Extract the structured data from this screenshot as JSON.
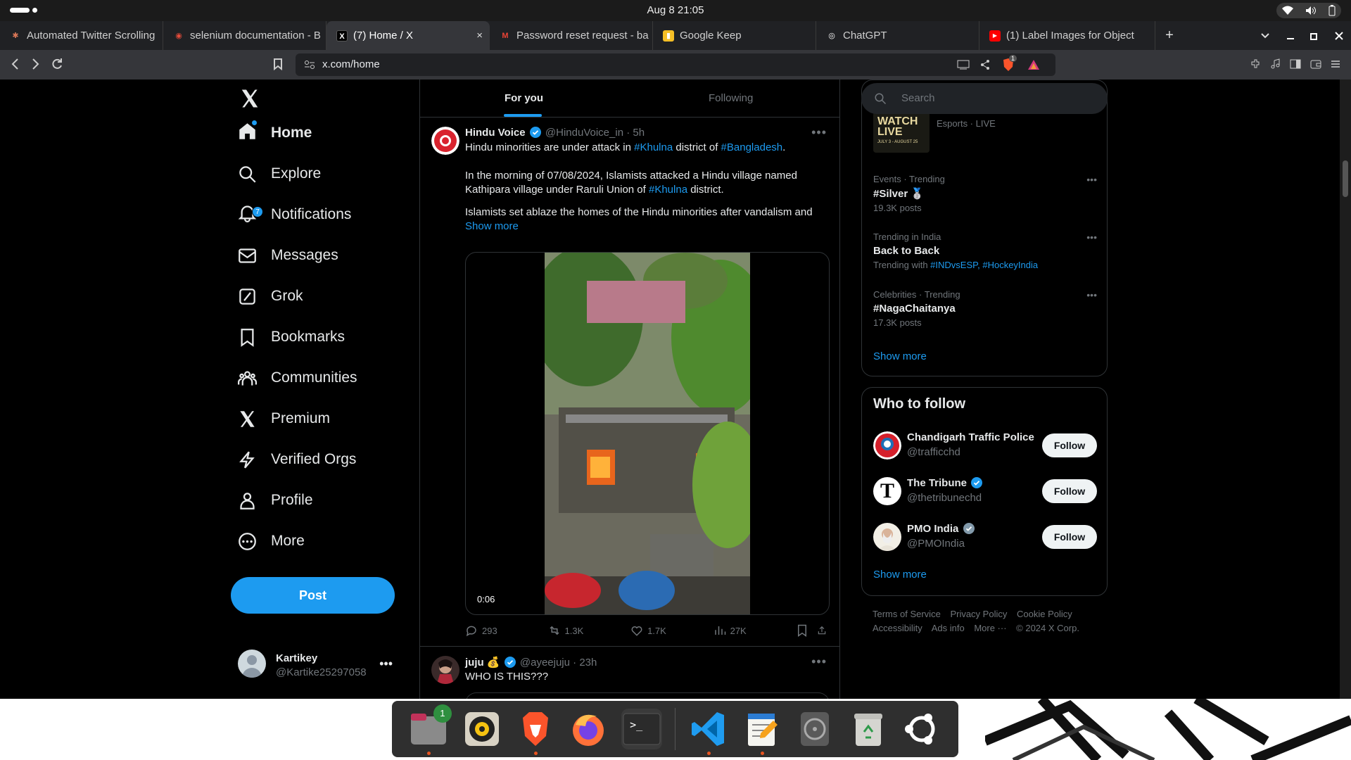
{
  "system": {
    "clock": "Aug 8  21:05"
  },
  "browser": {
    "tabs": [
      {
        "title": "Automated Twitter Scrolling",
        "favicon_color": "#d97757",
        "favicon": "✱"
      },
      {
        "title": "selenium documentation - B",
        "favicon_color": "#e44b3a",
        "favicon": "◉"
      },
      {
        "title": "(7) Home / X",
        "favicon_color": "#000000",
        "favicon": "X",
        "active": true,
        "close": "×"
      },
      {
        "title": "Password reset request - ba",
        "favicon_color": "#ffffff",
        "favicon": "M"
      },
      {
        "title": "Google Keep",
        "favicon_color": "#f6bf26",
        "favicon": "▮"
      },
      {
        "title": "ChatGPT",
        "favicon_color": "#ffffff",
        "favicon": "◎"
      },
      {
        "title": "(1) Label Images for Object",
        "favicon_color": "#ff0000",
        "favicon": "▶"
      }
    ],
    "new_tab": "+",
    "url": "x.com/home",
    "ext_badge": "1"
  },
  "sidebar": {
    "items": [
      {
        "label": "Home",
        "icon": "home-icon"
      },
      {
        "label": "Explore",
        "icon": "search-icon"
      },
      {
        "label": "Notifications",
        "icon": "bell-icon",
        "badge": "7"
      },
      {
        "label": "Messages",
        "icon": "envelope-icon"
      },
      {
        "label": "Grok",
        "icon": "grok-icon"
      },
      {
        "label": "Bookmarks",
        "icon": "bookmark-icon"
      },
      {
        "label": "Communities",
        "icon": "people-icon"
      },
      {
        "label": "Premium",
        "icon": "x-logo-icon"
      },
      {
        "label": "Verified Orgs",
        "icon": "lightning-icon"
      },
      {
        "label": "Profile",
        "icon": "person-icon"
      },
      {
        "label": "More",
        "icon": "more-circle-icon"
      }
    ],
    "post_label": "Post",
    "account": {
      "name": "Kartikey",
      "handle": "@Kartike25297058",
      "menu": "•••"
    }
  },
  "feed": {
    "tabs": [
      "For you",
      "Following"
    ],
    "tweet1": {
      "name": "Hindu Voice",
      "handle": "@HinduVoice_in",
      "sep": " · ",
      "time": "5h",
      "more": "•••",
      "line1_a": "Hindu minorities are under attack in ",
      "line1_tag1": "#Khulna",
      "line1_b": " district of ",
      "line1_tag2": "#Bangladesh",
      "line1_c": ".",
      "para2_a": "In the morning of 07/08/2024, Islamists attacked a Hindu village named Kathipara village under Raruli Union of ",
      "para2_tag": "#Khulna",
      "para2_b": " district.",
      "para3": "Islamists set ablaze the homes of the Hindu minorities after vandalism and",
      "show_more": "Show more",
      "duration": "0:06",
      "replies": "293",
      "reposts": "1.3K",
      "likes": "1.7K",
      "views": "27K"
    },
    "tweet2": {
      "name": "juju",
      "emoji": "💰",
      "handle": "@ayeejuju",
      "sep": " · ",
      "time": "23h",
      "more": "•••",
      "text": "WHO IS THIS???"
    }
  },
  "right": {
    "search_placeholder": "Search",
    "esports": {
      "watch": "WATCH LIVE",
      "dates": "JULY 3 - AUGUST 25",
      "meta": "Esports · LIVE"
    },
    "trends": [
      {
        "cat": "Events · Trending",
        "name": "#Silver",
        "emoji": "🥈",
        "posts": "19.3K posts"
      },
      {
        "cat": "Trending in India",
        "name": "Back to Back",
        "with_label": "Trending with ",
        "with_tags": "#INDvsESP, #HockeyIndia"
      },
      {
        "cat": "Celebrities · Trending",
        "name": "#NagaChaitanya",
        "posts": "17.3K posts"
      }
    ],
    "trend_dots": "•••",
    "trends_show_more": "Show more",
    "who_to_follow": {
      "title": "Who to follow",
      "accounts": [
        {
          "name": "Chandigarh Traffic Police",
          "handle": "@trafficchd",
          "btn": "Follow"
        },
        {
          "name": "The Tribune",
          "handle": "@thetribunechd",
          "btn": "Follow",
          "avatar_letter": "T"
        },
        {
          "name": "PMO India",
          "handle": "@PMOIndia",
          "btn": "Follow"
        }
      ],
      "show_more": "Show more"
    },
    "footer": {
      "links1": [
        "Terms of Service",
        "Privacy Policy",
        "Cookie Policy"
      ],
      "links2": [
        "Accessibility",
        "Ads info",
        "More ···",
        "© 2024 X Corp."
      ]
    }
  },
  "dock": {
    "files_badge": "1",
    "terminal_prompt": ">_",
    "apps": [
      "files",
      "rhythmbox",
      "brave",
      "firefox",
      "terminal",
      "vscode",
      "text-editor",
      "disk-utility",
      "trash",
      "ubuntu"
    ]
  },
  "colors": {
    "accent": "#1d9bf0",
    "bg": "#000000",
    "border": "#2f3336",
    "muted": "#71767b"
  }
}
